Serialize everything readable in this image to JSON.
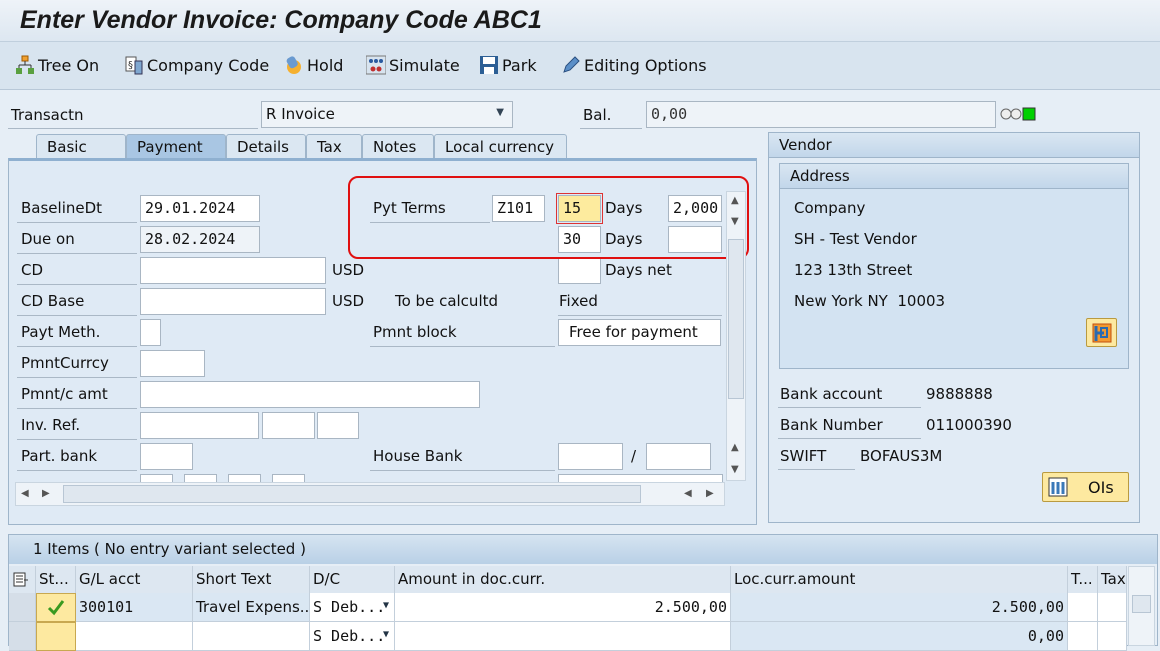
{
  "title": "Enter Vendor Invoice: Company Code ABC1",
  "toolbar": {
    "items": [
      {
        "label": "Tree On",
        "icon": "tree-icon"
      },
      {
        "label": "Company Code",
        "icon": "company-code-icon"
      },
      {
        "label": "Hold",
        "icon": "hold-icon"
      },
      {
        "label": "Simulate",
        "icon": "simulate-icon"
      },
      {
        "label": "Park",
        "icon": "save-disk-icon"
      },
      {
        "label": "Editing Options",
        "icon": "pencil-icon"
      }
    ]
  },
  "header": {
    "transaction_label": "Transactn",
    "transaction_value": "R Invoice",
    "balance_label": "Bal.",
    "balance_value": "0,00",
    "status_light": "green"
  },
  "tabs": [
    "Basic data",
    "Payment",
    "Details",
    "Tax",
    "Notes",
    "Local currency"
  ],
  "active_tab": "Payment",
  "payment": {
    "baseline_label": "BaselineDt",
    "baseline_value": "29.01.2024",
    "due_label": "Due on",
    "due_value": "28.02.2024",
    "cd_label": "CD",
    "cd_currency": "USD",
    "cd_base_label": "CD Base",
    "cd_base_currency": "USD",
    "to_be_calc": "To be calcultd",
    "fixed": "Fixed",
    "payt_meth_label": "Payt Meth.",
    "pmnt_block_label": "Pmnt block",
    "pmnt_block_value": "Free for payment",
    "pmnt_currcy_label": "PmntCurrcy",
    "pmnt_amt_label": "Pmnt/c amt",
    "inv_ref_label": "Inv. Ref.",
    "part_bank_label": "Part. bank",
    "house_bank_label": "House Bank",
    "house_bank_sep": "/",
    "pyt_terms_label": "Pyt Terms",
    "pyt_terms_value": "Z101",
    "days1": "15",
    "days1_label": "Days",
    "pct1": "2,000",
    "days2": "30",
    "days2_label": "Days",
    "days_net_label": "Days net"
  },
  "vendor": {
    "title": "Vendor",
    "address_title": "Address",
    "address_lines": [
      "Company",
      "SH - Test Vendor",
      "123 13th Street",
      "New York NY  10003"
    ],
    "bank_account_label": "Bank account",
    "bank_account": "9888888",
    "bank_number_label": "Bank Number",
    "bank_number": "011000390",
    "swift_label": "SWIFT",
    "swift": "BOFAUS3M",
    "ois_button": "OIs"
  },
  "items": {
    "header": "1 Items ( No entry variant selected )",
    "columns": [
      "St...",
      "G/L acct",
      "Short Text",
      "D/C",
      "Amount in doc.curr.",
      "Loc.curr.amount",
      "T...",
      "Tax"
    ],
    "rows": [
      {
        "status": "ok",
        "gl": "300101",
        "text": "Travel Expens...",
        "dc": "S Deb...",
        "amount": "2.500,00",
        "loc": "2.500,00"
      },
      {
        "status": "",
        "gl": "",
        "text": "",
        "dc": "S Deb...",
        "amount": "",
        "loc": "0,00"
      }
    ]
  }
}
